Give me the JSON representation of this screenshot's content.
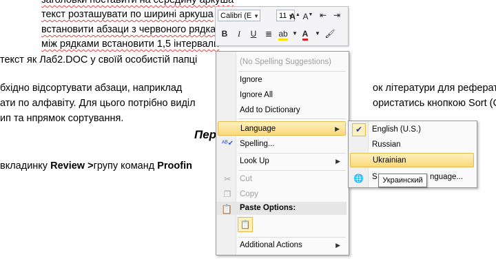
{
  "document": {
    "lines": [
      "заголовки поставити на середину аркуша",
      "текст розташувати по ширині аркуша",
      "встановити абзаци з червоного рядка",
      "між рядками встановити 1,5 інтервали",
      "текст як Лаб2.DOC у своїй особистій папці",
      "бхідно відсортувати абзаци, наприклад",
      "ок літератури для реферату",
      "ати по алфавіту. Для цього потрібно виділ",
      "ористатись кнопкою Sort (Сорт",
      "ип та нпрямок сортування.",
      "Пер"
    ],
    "review_line": {
      "pre": "вкладинку ",
      "bold1": "Review >",
      "mid": "групу команд ",
      "bold2": "Proofin"
    }
  },
  "mini_toolbar": {
    "font_name": "Calibri (E",
    "font_size": "11",
    "buttons": [
      "B",
      "I",
      "U"
    ]
  },
  "context_menu": {
    "no_suggestions": "(No Spelling Suggestions)",
    "ignore": "Ignore",
    "ignore_all": "Ignore All",
    "add_to_dictionary": "Add to Dictionary",
    "language": "Language",
    "spelling": "Spelling...",
    "look_up": "Look Up",
    "cut": "Cut",
    "copy": "Copy",
    "paste_options": "Paste Options:",
    "additional_actions": "Additional Actions"
  },
  "language_submenu": {
    "items": [
      "English (U.S.)",
      "Russian",
      "Ukrainian",
      "S",
      "nguage..."
    ],
    "checked": "English (U.S.)",
    "highlighted": "Ukrainian"
  },
  "tooltip": "Украинский"
}
